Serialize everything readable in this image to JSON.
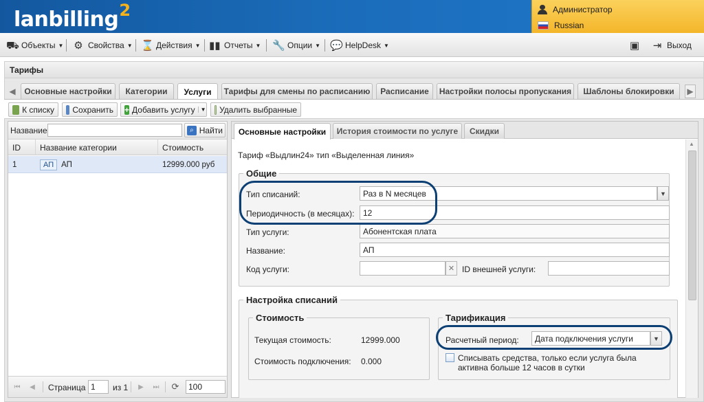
{
  "header": {
    "logo_text": "lanbilling",
    "logo_sup": "2",
    "user_name": "Администратор",
    "language": "Russian"
  },
  "menu": {
    "objects": "Объекты",
    "properties": "Свойства",
    "actions": "Действия",
    "reports": "Отчеты",
    "options": "Опции",
    "helpdesk": "HelpDesk",
    "logout": "Выход"
  },
  "page": {
    "title": "Тарифы"
  },
  "tabs": [
    "Основные настройки",
    "Категории",
    "Услуги",
    "Тарифы для смены по расписанию",
    "Расписание",
    "Настройки полосы пропускания",
    "Шаблоны блокировки"
  ],
  "active_tab": "Услуги",
  "toolbar": {
    "back": "К списку",
    "save": "Сохранить",
    "add_service": "Добавить услугу",
    "delete_selected": "Удалить выбранные"
  },
  "left": {
    "search_label": "Название:",
    "search_value": "",
    "find_button": "Найти",
    "columns": [
      "ID",
      "Название категории",
      "Стоимость"
    ],
    "rows": [
      {
        "id": "1",
        "badge": "АП",
        "name": "АП",
        "cost": "12999.000 руб"
      }
    ],
    "pager": {
      "page_label": "Страница",
      "page_value": "1",
      "of_label": "из 1",
      "page_size": "100"
    }
  },
  "right": {
    "subtabs": [
      "Основные настройки",
      "История стоимости по услуге",
      "Скидки"
    ],
    "tariff_line": "Тариф «Выдлин24» тип «Выделенная линия»",
    "general": {
      "legend": "Общие",
      "charge_type_label": "Тип списаний:",
      "charge_type_value": "Раз в N месяцев",
      "periodicity_label": "Периодичность (в месяцах):",
      "periodicity_value": "12",
      "service_type_label": "Тип услуги:",
      "service_type_value": "Абонентская плата",
      "name_label": "Название:",
      "name_value": "АП",
      "service_code_label": "Код услуги:",
      "service_code_value": "",
      "external_id_label": "ID внешней услуги:",
      "external_id_value": ""
    },
    "charges": {
      "legend": "Настройка списаний",
      "cost": {
        "legend": "Стоимость",
        "current_cost_label": "Текущая стоимость:",
        "current_cost_value": "12999.000",
        "connection_cost_label": "Стоимость подключения:",
        "connection_cost_value": "0.000"
      },
      "billing": {
        "legend": "Тарификация",
        "period_label": "Расчетный период:",
        "period_value": "Дата подключения услуги",
        "checkbox_text_1": "Списывать средства, только если услуга была",
        "checkbox_text_2": "активна больше 12 часов в сутки"
      }
    }
  },
  "colors": {
    "header_blue": "#1b6dbb",
    "user_panel_yellow": "#f4b62a",
    "logo_accent": "#f5b21a",
    "highlight_oval": "#0c3f73",
    "selected_row": "#dfe8f6"
  }
}
